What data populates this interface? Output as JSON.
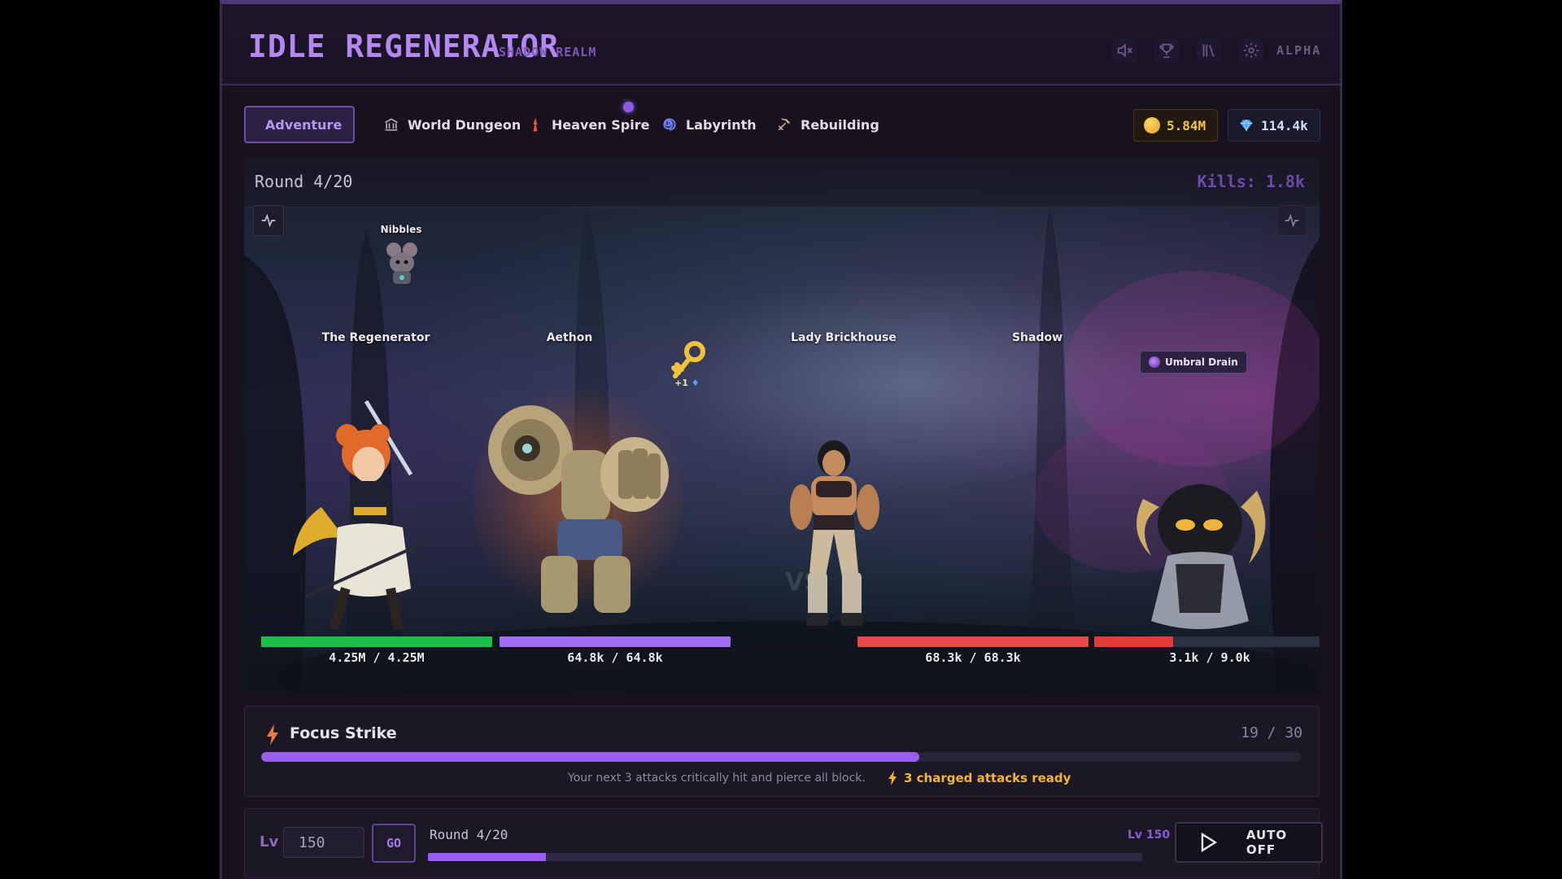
{
  "header": {
    "title": "IDLE REGENERATOR",
    "subtitle": "SHADOW REALM",
    "badge": "ALPHA",
    "icons": [
      "mute-icon",
      "trophy-icon",
      "library-icon",
      "gear-icon"
    ]
  },
  "tabs": [
    {
      "label": "Adventure",
      "icon": "crossed-swords-icon",
      "active": true
    },
    {
      "label": "World Dungeon",
      "icon": "temple-icon",
      "active": false
    },
    {
      "label": "Heaven Spire",
      "icon": "spire-icon",
      "active": false
    },
    {
      "label": "Labyrinth",
      "icon": "spiral-icon",
      "active": false
    },
    {
      "label": "Rebuilding",
      "icon": "hammer-pick-icon",
      "active": false
    }
  ],
  "currency": {
    "gold": "5.84M",
    "gems": "114.4k"
  },
  "battle": {
    "round_text": "Round 4/20",
    "kills_text": "Kills: 1.8k",
    "pet": {
      "name": "Nibbles"
    },
    "loot_drop": {
      "icon": "key-icon",
      "text": "+1"
    },
    "units": [
      {
        "name": "The Regenerator",
        "side": "ally",
        "hp_text": "4.25M / 4.25M",
        "hp_fraction": 1.0,
        "hp_color": "#19c04a"
      },
      {
        "name": "Aethon",
        "side": "ally",
        "hp_text": "64.8k / 64.8k",
        "hp_fraction": 1.0,
        "hp_color": "#a06df0"
      },
      {
        "name": "Lady Brickhouse",
        "side": "enemy",
        "hp_text": "68.3k / 68.3k",
        "hp_fraction": 1.0,
        "hp_color": "#ea4747"
      },
      {
        "name": "Shadow",
        "side": "enemy",
        "hp_text": "3.1k / 9.0k",
        "hp_fraction": 0.34,
        "hp_color": "#e33a3a",
        "buff": "Umbral Drain"
      }
    ]
  },
  "focus_strike": {
    "title": "Focus Strike",
    "count_text": "19 / 30",
    "progress": 0.633,
    "description": "Your next 3 attacks critically hit and pierce all block.",
    "charged_text": "3 charged attacks ready"
  },
  "level_bar": {
    "lv_label": "Lv",
    "level_value": "150",
    "go_label": "GO",
    "round_text": "Round 4/20",
    "max_level_text": "Lv 150",
    "progress": 0.165,
    "auto_label": "AUTO OFF"
  },
  "colors": {
    "accent": "#9a5ef0",
    "gold": "#f3c641",
    "charged": "#f2b62f"
  }
}
